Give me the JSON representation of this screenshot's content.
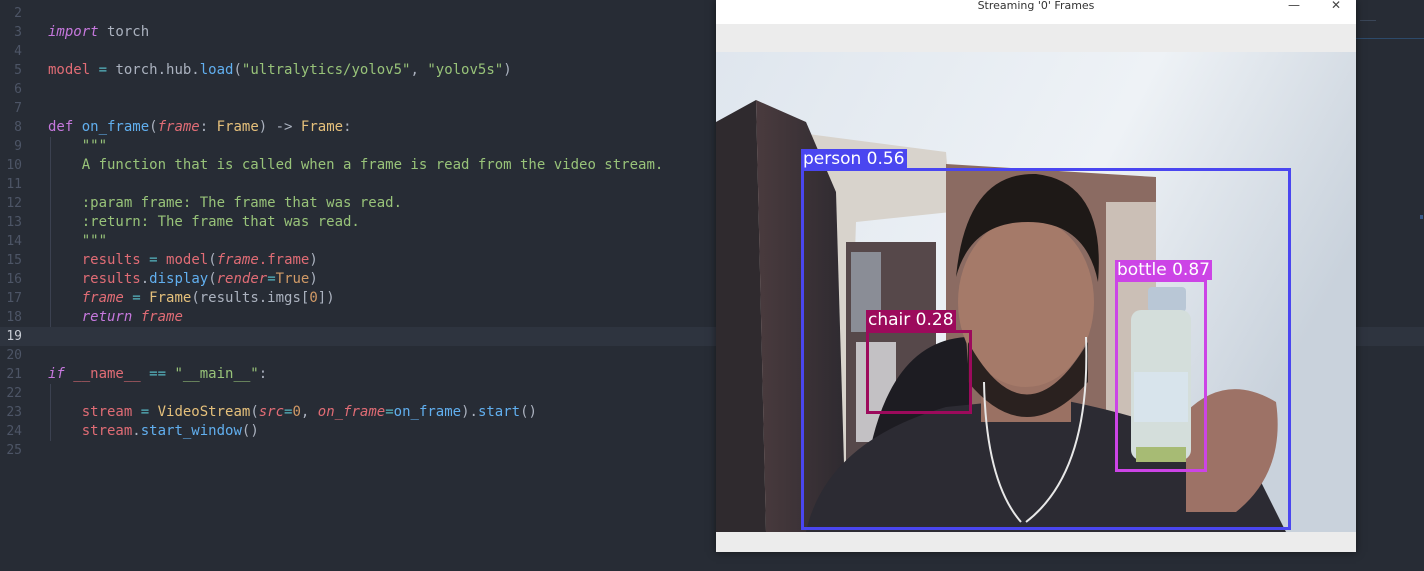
{
  "editor": {
    "current_line": "19",
    "lines": [
      {
        "n": "2"
      },
      {
        "n": "3"
      },
      {
        "n": "4"
      },
      {
        "n": "5"
      },
      {
        "n": "6"
      },
      {
        "n": "7"
      },
      {
        "n": "8"
      },
      {
        "n": "9"
      },
      {
        "n": "10"
      },
      {
        "n": "11"
      },
      {
        "n": "12"
      },
      {
        "n": "13"
      },
      {
        "n": "14"
      },
      {
        "n": "15"
      },
      {
        "n": "16"
      },
      {
        "n": "17"
      },
      {
        "n": "18"
      },
      {
        "n": "19"
      },
      {
        "n": "20"
      },
      {
        "n": "21"
      },
      {
        "n": "22"
      },
      {
        "n": "23"
      },
      {
        "n": "24"
      },
      {
        "n": "25"
      }
    ],
    "code": {
      "l3_kw": "import",
      "l3_mod": " torch",
      "l5_var": "model",
      "l5_eq": " = ",
      "l5_obj": "torch.hub.",
      "l5_fn": "load",
      "l5_p1": "(",
      "l5_s1": "\"ultralytics/yolov5\"",
      "l5_c": ", ",
      "l5_s2": "\"yolov5s\"",
      "l5_p2": ")",
      "l8_def": "def ",
      "l8_fn": "on_frame",
      "l8_p1": "(",
      "l8_arg": "frame",
      "l8_col": ": ",
      "l8_type": "Frame",
      "l8_arrow": ") -> ",
      "l8_ret": "Frame",
      "l8_end": ":",
      "l9": "    \"\"\"",
      "l10": "    A function that is called when a frame is read from the video stream.",
      "l12": "    :param frame: The frame that was read.",
      "l13": "    :return: The frame that was read.",
      "l14": "    \"\"\"",
      "l15_ind": "    ",
      "l15_var": "results",
      "l15_eq": " = ",
      "l15_fn": "model",
      "l15_p1": "(",
      "l15_arg": "frame",
      "l15_attr": ".frame",
      "l15_p2": ")",
      "l16_ind": "    ",
      "l16_var": "results",
      "l16_dot": ".",
      "l16_fn": "display",
      "l16_p1": "(",
      "l16_kw": "render",
      "l16_eq": "=",
      "l16_val": "True",
      "l16_p2": ")",
      "l17_ind": "    ",
      "l17_var": "frame",
      "l17_eq": " = ",
      "l17_cls": "Frame",
      "l17_p1": "(results.imgs[",
      "l17_num": "0",
      "l17_p2": "])",
      "l18_ind": "    ",
      "l18_kw": "return",
      "l18_var": " frame",
      "l21_if": "if",
      "l21_name": " __name__",
      "l21_eq": " == ",
      "l21_str": "\"__main__\"",
      "l21_end": ":",
      "l23_ind": "    ",
      "l23_var": "stream",
      "l23_eq": " = ",
      "l23_cls": "VideoStream",
      "l23_p1": "(",
      "l23_k1": "src",
      "l23_e1": "=",
      "l23_n1": "0",
      "l23_c": ", ",
      "l23_k2": "on_frame",
      "l23_e2": "=",
      "l23_v2": "on_frame",
      "l23_p2": ").",
      "l23_fn": "start",
      "l23_p3": "()",
      "l24_ind": "    ",
      "l24_var": "stream",
      "l24_dot": ".",
      "l24_fn": "start_window",
      "l24_p": "()"
    }
  },
  "window": {
    "title": "Streaming '0' Frames",
    "minimize_glyph": "—",
    "close_glyph": "✕",
    "detections": [
      {
        "label": "person 0.56",
        "color": "#4a46f0"
      },
      {
        "label": "chair 0.28",
        "color": "#9c0a5c"
      },
      {
        "label": "bottle 0.87",
        "color": "#cc44e6"
      }
    ]
  },
  "colors": {
    "editor_bg": "#272c35",
    "keyword": "#c678dd",
    "function": "#61afef",
    "string": "#98c379",
    "variable": "#e06c75"
  }
}
